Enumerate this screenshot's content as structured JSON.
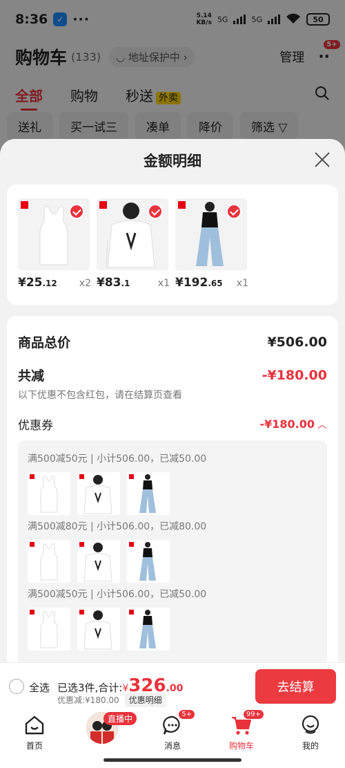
{
  "status_bar": {
    "time": "8:36",
    "net_speed_value": "5.14",
    "net_speed_unit": "KB/s",
    "net_type_1": "5G",
    "net_type_2": "5G",
    "battery": "50"
  },
  "cart_header": {
    "title": "购物车",
    "count": "(133)",
    "address": "地址保护中",
    "manage": "管理",
    "more_badge": "5+"
  },
  "cart_tabs": [
    "全部",
    "购物",
    "秒送"
  ],
  "waimai": "外卖",
  "chips": [
    "送礼",
    "买一试三",
    "凑单",
    "降价",
    "筛选"
  ],
  "sheet": {
    "title": "金额明细",
    "products": [
      {
        "price_main": "¥25",
        "price_dec": ".12",
        "qty": "x2"
      },
      {
        "price_main": "¥83",
        "price_dec": ".1",
        "qty": "x1"
      },
      {
        "price_main": "¥192",
        "price_dec": ".65",
        "qty": "x1"
      }
    ],
    "total_label": "商品总价",
    "total_value": "¥506.00",
    "reduce_label": "共减",
    "reduce_value": "-¥180.00",
    "reduce_note": "以下优惠不包含红包，请在结算页查看",
    "coupon_label": "优惠券",
    "coupon_value": "-¥180.00",
    "coupon_lines": [
      "满500减50元 | 小计506.00，已减50.00",
      "满500减80元 | 小计506.00，已减80.00",
      "满500减50元 | 小计506.00，已减50.00"
    ]
  },
  "checkout": {
    "select_all": "全选",
    "selected_text": "已选3件,合计:",
    "total_yen": "¥",
    "total_int": "326",
    "total_dec": ".00",
    "discount": "优惠减:¥180.00",
    "detail_btn": "优惠明细",
    "checkout_btn": "去结算"
  },
  "bottom_nav": {
    "home": "首页",
    "live_badge": "直播中",
    "messages": "消息",
    "messages_badge": "5+",
    "cart": "购物车",
    "cart_badge": "99+",
    "mine": "我的"
  },
  "colors": {
    "accent_red": "#e8333d",
    "checkout_button": "#ec3a41",
    "waimai_yellow": "#ffd600"
  }
}
